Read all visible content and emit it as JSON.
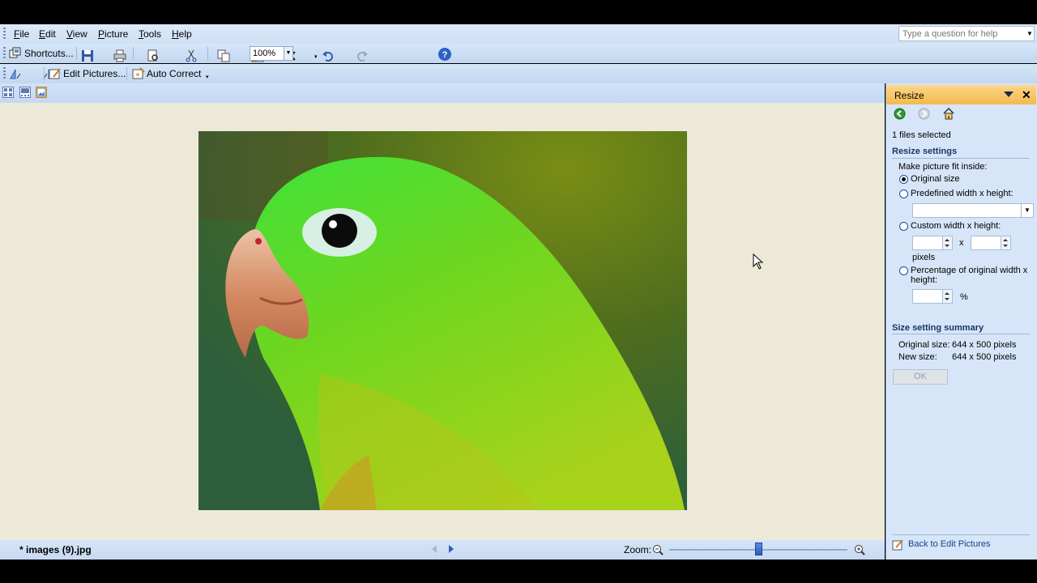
{
  "menubar": {
    "items": [
      "File",
      "Edit",
      "View",
      "Picture",
      "Tools",
      "Help"
    ],
    "help_placeholder": "Type a question for help"
  },
  "toolbar1": {
    "shortcuts_label": "Shortcuts...",
    "zoom_value": "100%"
  },
  "toolbar2": {
    "edit_pictures_label": "Edit Pictures...",
    "auto_correct_label": "Auto Correct"
  },
  "statusbar": {
    "filename": "* images (9).jpg",
    "zoom_label": "Zoom:",
    "zoom_level": 0.5
  },
  "pane": {
    "title": "Resize",
    "files_selected": "1 files selected",
    "resize_settings_heading": "Resize settings",
    "fit_inside_label": "Make picture fit inside:",
    "option_original": "Original size",
    "option_predefined": "Predefined width x height:",
    "option_custom": "Custom width x height:",
    "custom_separator": "x",
    "custom_units": "pixels",
    "option_percentage": "Percentage of original width x height:",
    "percent_symbol": "%",
    "summary_heading": "Size setting summary",
    "original_size_label": "Original size:",
    "original_size_value": "644 x 500 pixels",
    "new_size_label": "New size:",
    "new_size_value": "644 x 500 pixels",
    "ok_label": "OK",
    "back_link": "Back to Edit Pictures"
  }
}
